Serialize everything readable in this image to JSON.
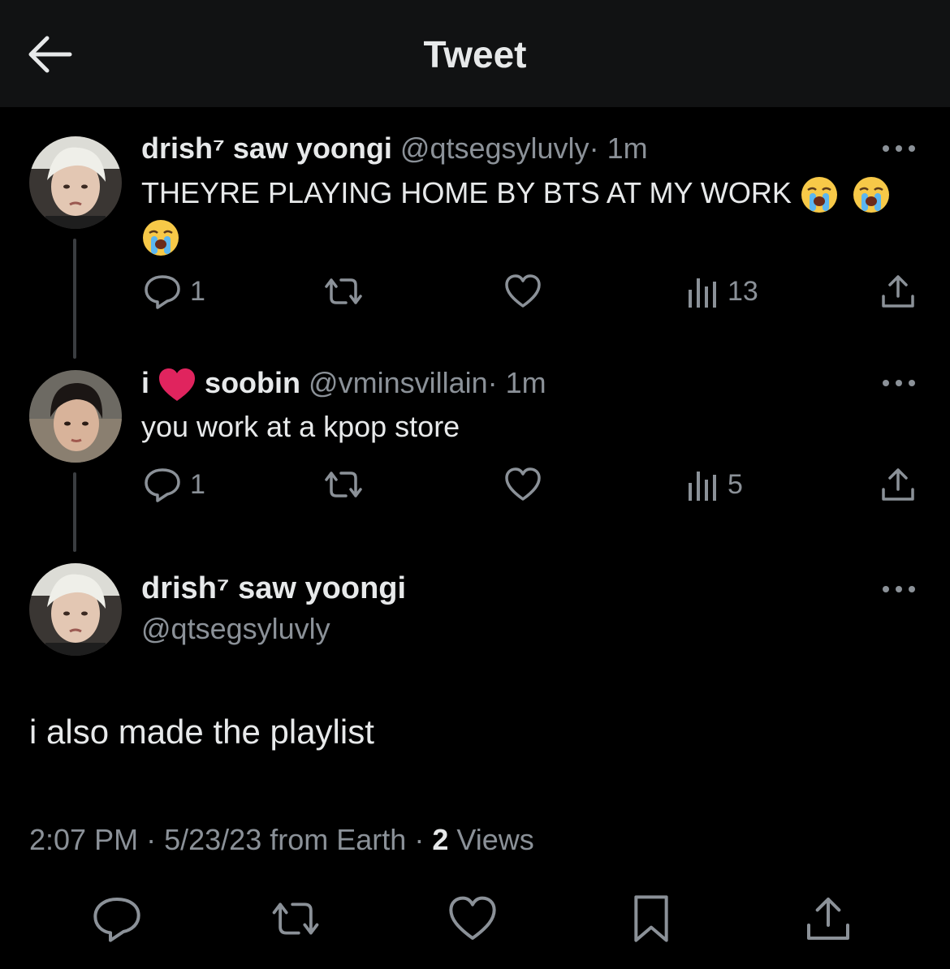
{
  "header": {
    "title": "Tweet"
  },
  "tweets": [
    {
      "name": "drish⁷ saw yoongi",
      "handle": "@qtsegsyluvly",
      "dot": "·",
      "time": "1m",
      "text": "THEYRE PLAYING HOME BY BTS AT MY WORK",
      "replies": "1",
      "views": "13"
    },
    {
      "name_prefix": "i",
      "name": "soobin",
      "handle": "@vminsvillain",
      "dot": "·",
      "time": "1m",
      "text": "you work at a kpop store",
      "replies": "1",
      "views": "5"
    }
  ],
  "main": {
    "name": "drish⁷ saw yoongi",
    "handle": "@qtsegsyluvly",
    "text": "i also made the playlist",
    "time": "2:07 PM",
    "sep1": "·",
    "date": "5/23/23",
    "source": "from Earth",
    "sep2": "·",
    "views_count": "2",
    "views_label": "Views"
  },
  "colors": {
    "background": "#000000",
    "header": "#111213",
    "muted": "#8b9198",
    "text": "#e7e9ea",
    "heart": "#e0245e"
  }
}
